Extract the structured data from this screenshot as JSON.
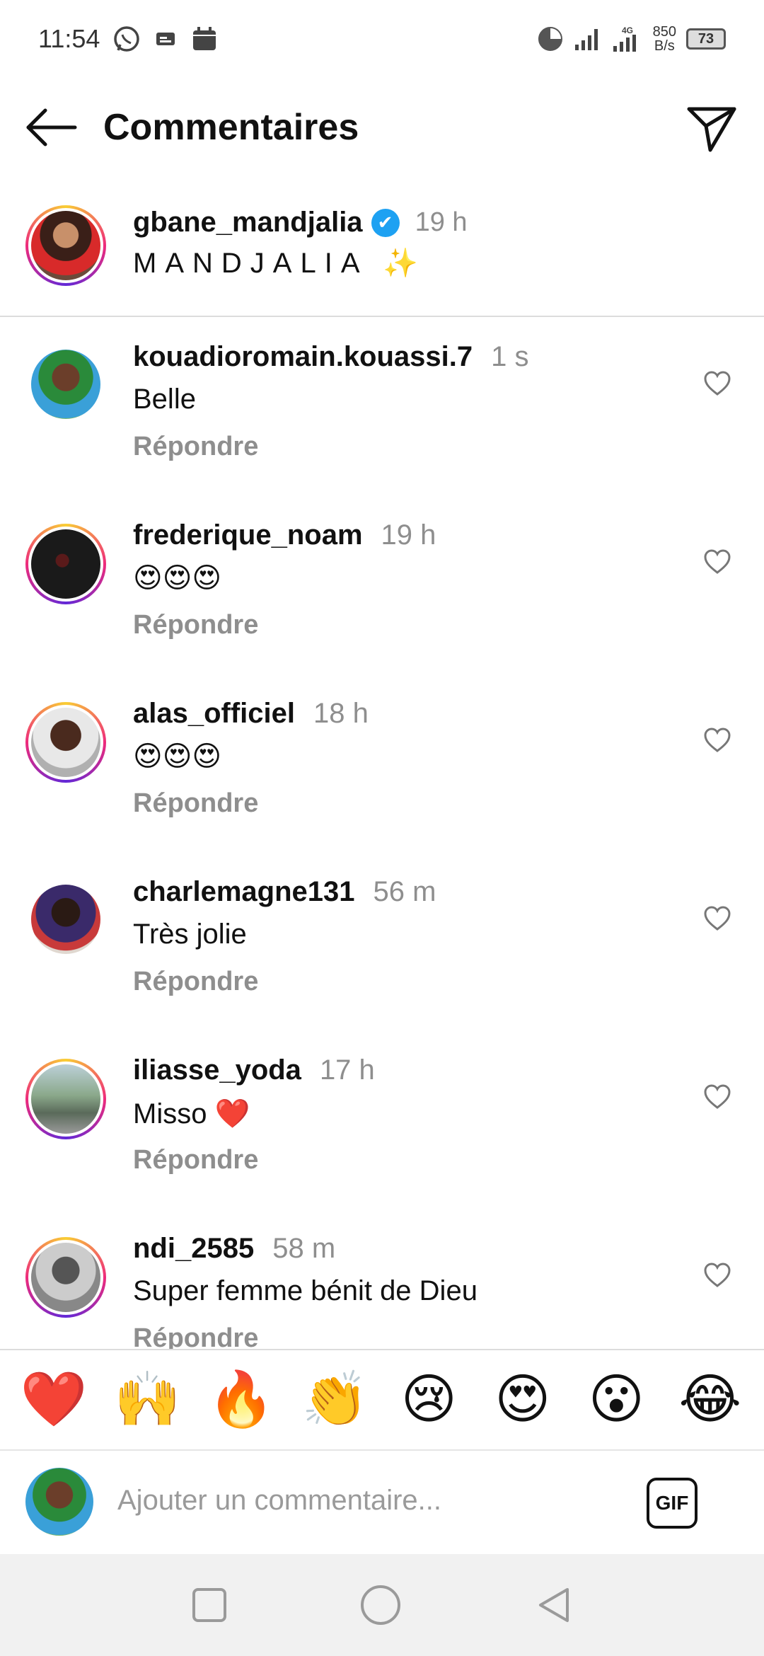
{
  "status_bar": {
    "time": "11:54",
    "net_type": "4G",
    "speed_value": "850",
    "speed_unit": "B/s",
    "battery": "73"
  },
  "header": {
    "title": "Commentaires"
  },
  "caption": {
    "username": "gbane_mandjalia",
    "verified_icon": "✔",
    "time": "19 h",
    "text": "MANDJALIA ✨"
  },
  "comments": [
    {
      "username": "kouadioromain.kouassi.7",
      "time": "1 s",
      "text": "Belle",
      "reply": "Répondre"
    },
    {
      "username": "frederique_noam",
      "time": "19 h",
      "text": "😍😍😍",
      "reply": "Répondre"
    },
    {
      "username": "alas_officiel",
      "time": "18 h",
      "text": "😍😍😍",
      "reply": "Répondre"
    },
    {
      "username": "charlemagne131",
      "time": "56 m",
      "text": "Très jolie",
      "reply": "Répondre"
    },
    {
      "username": "iliasse_yoda",
      "time": "17 h",
      "text": "Misso ❤️",
      "reply": "Répondre"
    },
    {
      "username": "ndi_2585",
      "time": "58 m",
      "text": "Super femme bénit de Dieu",
      "reply": "Répondre"
    }
  ],
  "emoji_bar": [
    "❤️",
    "🙌",
    "🔥",
    "👏",
    "😢",
    "😍",
    "😮",
    "😂"
  ],
  "input": {
    "placeholder": "Ajouter un commentaire...",
    "gif_label": "GIF"
  },
  "colors": {
    "accent_verified": "#1da1f2",
    "muted_text": "#8e8e8e"
  }
}
